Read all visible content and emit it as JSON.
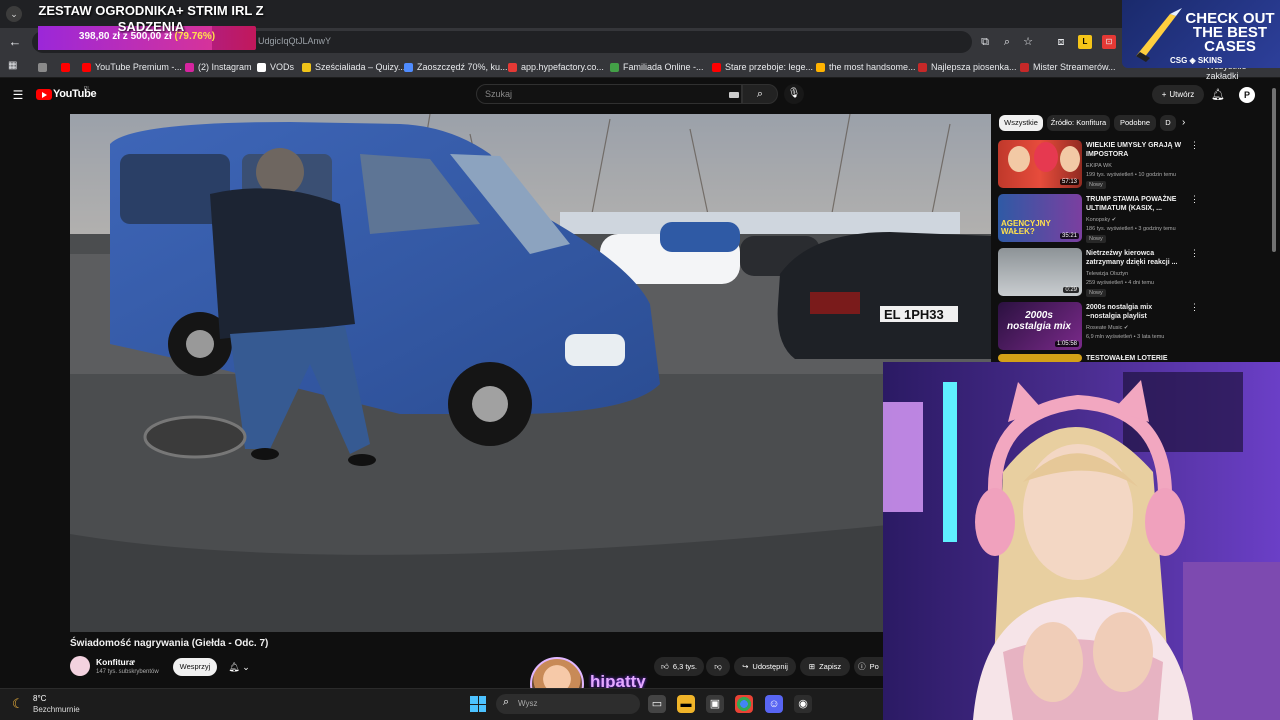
{
  "browser": {
    "url_visible": "UdgicIqQtJLAnwY",
    "bookmarks": [
      {
        "label": "",
        "color": "#8a8a8a"
      },
      {
        "label": "",
        "color": "#ff0000"
      },
      {
        "label": "YouTube Premium -...",
        "color": "#ff0000"
      },
      {
        "label": "(2) Instagram",
        "color": "#d6249f"
      },
      {
        "label": "VODs",
        "color": "#ffffff"
      },
      {
        "label": "Sześcialiada – Quizy...",
        "color": "#f0c419"
      },
      {
        "label": "Zaoszczędź 70%, ku...",
        "color": "#4f8cff"
      },
      {
        "label": "app.hypefactory.co...",
        "color": "#e53935"
      },
      {
        "label": "Familiada Online -...",
        "color": "#43a047"
      },
      {
        "label": "Stare przeboje: lege...",
        "color": "#ff0000"
      },
      {
        "label": "the most handsome...",
        "color": "#ffb300"
      },
      {
        "label": "Najlepsza piosenka...",
        "color": "#c62828"
      },
      {
        "label": "Mister Streamerów...",
        "color": "#c62828"
      }
    ],
    "all_bookmarks": "Wszystkie zakładki"
  },
  "overlay": {
    "goal_title": "ZESTAW OGRODNIKA+ STRIM IRL Z SADZENIA",
    "goal_amount": "398,80 zł z 500,00 zł",
    "goal_percent": "(79.76%)",
    "goal_progress": 0.7976,
    "ad_text": "CHECK OUT THE BEST CASES",
    "ad_brand": "CSG ◈ SKINS",
    "streamer_handle": "hipatty"
  },
  "youtube": {
    "logo_text": "YouTube",
    "region": "PL",
    "search_placeholder": "Szukaj",
    "create_label": "Utwórz",
    "avatar_letter": "P",
    "video_title": "Świadomość nagrywania (Giełda - Odc. 7)",
    "channel_name": "Konfitura",
    "channel_subs": "147 tys. subskrybentów",
    "support_label": "Wesprzyj",
    "likes": "6,3 tys.",
    "share_label": "Udostępnij",
    "save_label": "Zapisz",
    "more_label": "Po",
    "plate": "EL 1PH33",
    "chips": [
      "Wszystkie",
      "Źródło: Konfitura",
      "Podobne",
      "D"
    ],
    "recommendations": [
      {
        "title": "WIELKIE UMYSŁY GRAJĄ W IMPOSTORA",
        "channel": "EKIPA WK",
        "meta": "199 tys. wyświetleń • 10 godzin temu",
        "badge": "Nowy",
        "duration": "57:13",
        "thumb_text": ""
      },
      {
        "title": "TRUMP STAWIA POWAŻNE ULTIMATUM (KASIX, ...",
        "channel": "Konopsky ✔",
        "meta": "186 tys. wyświetleń • 3 godziny temu",
        "badge": "Nowy",
        "duration": "35:21",
        "thumb_text": "AGENCYJNY WAŁEK?"
      },
      {
        "title": "Nietrzeźwy kierowca zatrzymany dzięki reakcji ...",
        "channel": "Telewizja Olsztyn",
        "meta": "259 wyświetleń • 4 dni temu",
        "badge": "Nowy",
        "duration": "0:29",
        "thumb_text": ""
      },
      {
        "title": "2000s nostalgia mix ~nostalgia playlist",
        "channel": "Roseate Music ✔",
        "meta": "6,9 mln wyświetleń • 3 lata temu",
        "badge": "",
        "duration": "1:05:58",
        "thumb_text": "2000s nostalgia mix"
      },
      {
        "title": "TESTOWAŁEM LOTERIE PRZEZ",
        "channel": "",
        "meta": "",
        "badge": "",
        "duration": "",
        "thumb_text": ""
      }
    ]
  },
  "taskbar": {
    "temperature": "8°C",
    "condition": "Bezchmurnie",
    "search_placeholder": "Wysz"
  }
}
